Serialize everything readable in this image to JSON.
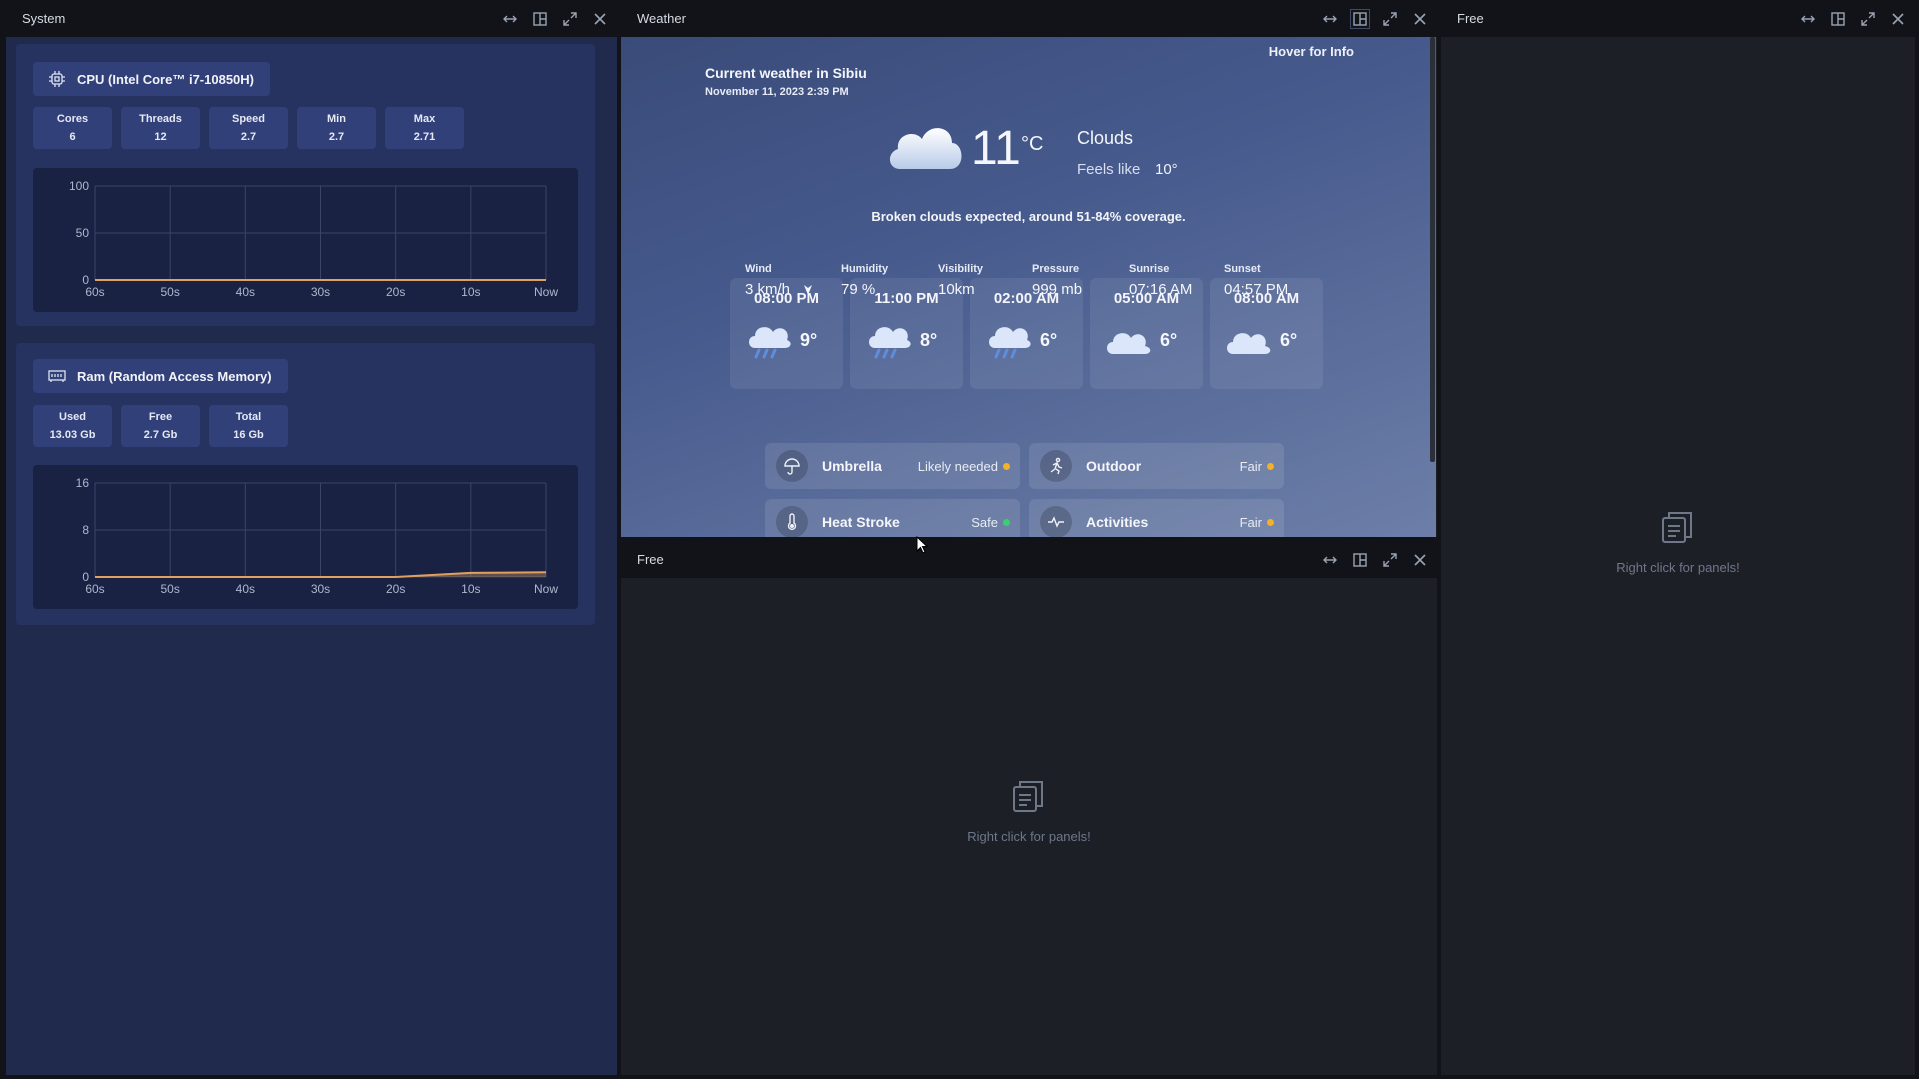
{
  "panels": {
    "system": {
      "title": "System"
    },
    "weather": {
      "title": "Weather"
    },
    "free_right": {
      "title": "Free",
      "empty_hint": "Right click for panels!"
    },
    "free_bottom": {
      "title": "Free",
      "empty_hint": "Right click for panels!"
    }
  },
  "cpu": {
    "title": "CPU (Intel Core™ i7-10850H)",
    "stats": [
      {
        "label": "Cores",
        "value": "6"
      },
      {
        "label": "Threads",
        "value": "12"
      },
      {
        "label": "Speed",
        "value": "2.7"
      },
      {
        "label": "Min",
        "value": "2.7"
      },
      {
        "label": "Max",
        "value": "2.71"
      }
    ],
    "chart_data": {
      "type": "line",
      "x": [
        "60s",
        "50s",
        "40s",
        "30s",
        "20s",
        "10s",
        "Now"
      ],
      "yticks": [
        "100",
        "50",
        "0"
      ],
      "ylim": [
        0,
        100
      ],
      "series": [
        {
          "values": [
            0,
            0,
            0,
            0,
            0,
            0,
            0
          ],
          "color": "#e0a060"
        }
      ]
    }
  },
  "ram": {
    "title": "Ram (Random Access Memory)",
    "stats": [
      {
        "label": "Used",
        "value": "13.03 Gb"
      },
      {
        "label": "Free",
        "value": "2.7 Gb"
      },
      {
        "label": "Total",
        "value": "16 Gb"
      }
    ],
    "chart_data": {
      "type": "area",
      "x": [
        "60s",
        "50s",
        "40s",
        "30s",
        "20s",
        "10s",
        "Now"
      ],
      "yticks": [
        "16",
        "8",
        "0"
      ],
      "ylim": [
        0,
        16
      ],
      "series": [
        {
          "values": [
            0,
            0,
            0,
            0,
            0,
            0.7,
            0.8
          ],
          "color": "#e0a060"
        }
      ]
    }
  },
  "weather": {
    "hover_hint": "Hover for Info",
    "heading": "Current weather in Sibiu",
    "datetime": "November 11, 2023 2:39 PM",
    "temp": "11",
    "unit": "°C",
    "condition": "Clouds",
    "feels_like_label": "Feels like",
    "feels_like": "10°",
    "summary": "Broken clouds expected, around 51-84% coverage.",
    "metrics": [
      {
        "label": "Wind",
        "value": "3 km/h"
      },
      {
        "label": "Humidity",
        "value": "79 %"
      },
      {
        "label": "Visibility",
        "value": "10km"
      },
      {
        "label": "Pressure",
        "value": "999 mb"
      },
      {
        "label": "Sunrise",
        "value": "07:16 AM"
      },
      {
        "label": "Sunset",
        "value": "04:57 PM"
      }
    ],
    "forecast": [
      {
        "time": "08:00 PM",
        "temp": "9°",
        "icon": "rain-cloud-icon"
      },
      {
        "time": "11:00 PM",
        "temp": "8°",
        "icon": "rain-cloud-icon"
      },
      {
        "time": "02:00 AM",
        "temp": "6°",
        "icon": "rain-cloud-icon"
      },
      {
        "time": "05:00 AM",
        "temp": "6°",
        "icon": "cloud-icon"
      },
      {
        "time": "08:00 AM",
        "temp": "6°",
        "icon": "cloud-icon"
      }
    ],
    "indicators": [
      {
        "label": "Umbrella",
        "value": "Likely needed",
        "status_color": "#f2b12b",
        "icon": "umbrella-icon"
      },
      {
        "label": "Outdoor",
        "value": "Fair",
        "status_color": "#f2b12b",
        "icon": "running-icon"
      },
      {
        "label": "Heat Stroke",
        "value": "Safe",
        "status_color": "#3ccf6e",
        "icon": "thermometer-icon"
      },
      {
        "label": "Activities",
        "value": "Fair",
        "status_color": "#f2b12b",
        "icon": "pulse-icon"
      }
    ]
  }
}
